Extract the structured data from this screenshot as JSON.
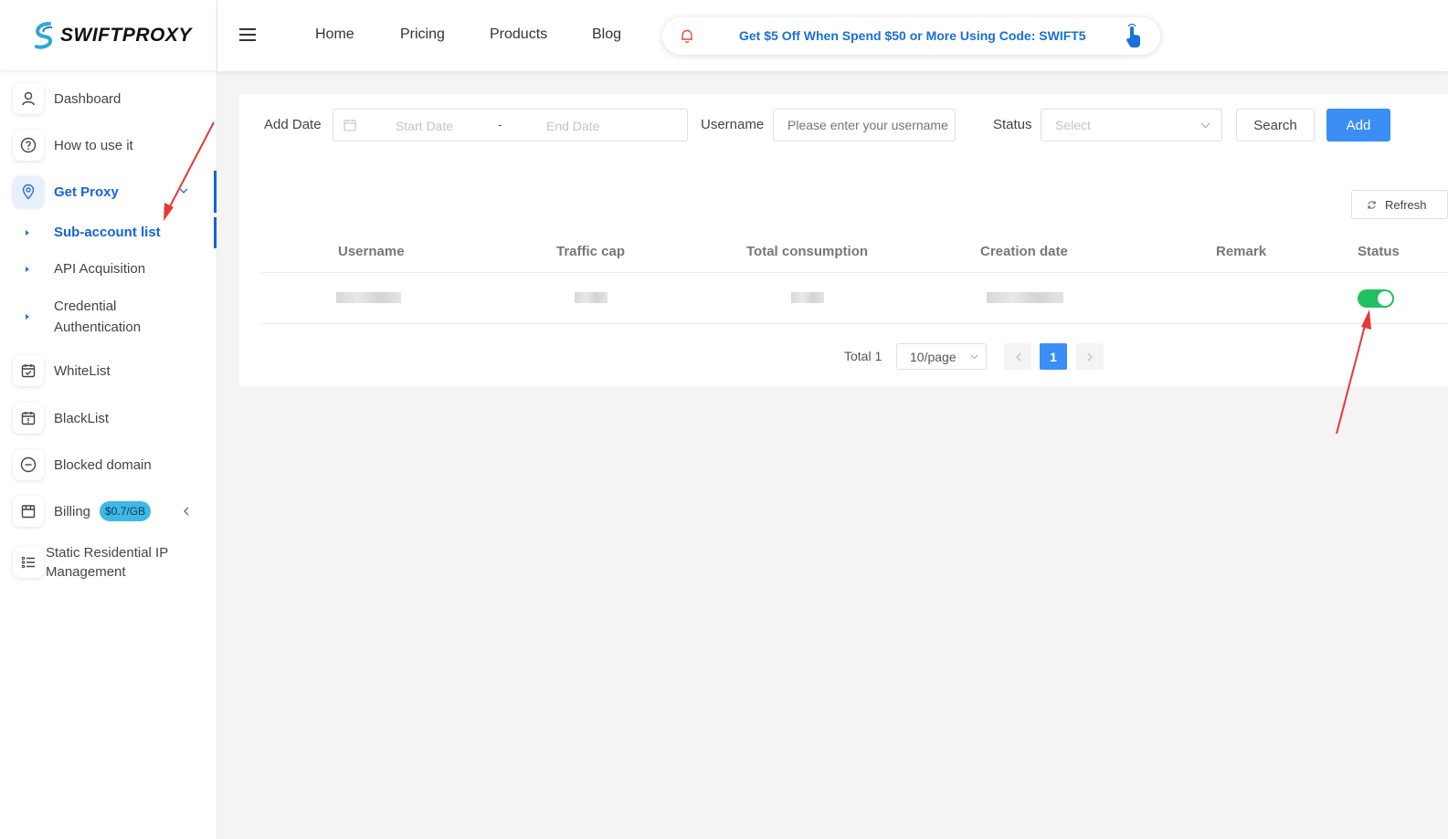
{
  "brand": {
    "name": "SWIFTPROXY"
  },
  "header": {
    "nav": [
      "Home",
      "Pricing",
      "Products",
      "Blog"
    ],
    "promo_text": "Get $5 Off When Spend $50 or More Using Code: SWIFT5"
  },
  "sidebar": {
    "items": [
      {
        "label": "Dashboard",
        "icon": "user-icon"
      },
      {
        "label": "How to use it",
        "icon": "help-icon"
      },
      {
        "label": "Get Proxy",
        "icon": "location-pin-icon",
        "active": true
      },
      {
        "label": "WhiteList",
        "icon": "calendar-check-icon"
      },
      {
        "label": "BlackList",
        "icon": "calendar-alert-icon"
      },
      {
        "label": "Blocked domain",
        "icon": "minus-circle-icon"
      },
      {
        "label": "Billing",
        "icon": "store-icon",
        "badge": "$0.7/GB"
      },
      {
        "label_line1": "Static Residential IP",
        "label_line2": "Management",
        "icon": "list-icon"
      }
    ],
    "sub_items": [
      {
        "label": "Sub-account list",
        "active": true
      },
      {
        "label": "API Acquisition"
      },
      {
        "label_line1": "Credential",
        "label_line2": "Authentication"
      }
    ]
  },
  "filters": {
    "add_date_label": "Add Date",
    "start_placeholder": "Start Date",
    "range_separator": "-",
    "end_placeholder": "End Date",
    "username_label": "Username",
    "username_placeholder": "Please enter your username",
    "status_label": "Status",
    "status_placeholder": "Select",
    "search_label": "Search",
    "add_label": "Add"
  },
  "table": {
    "refresh_label": "Refresh",
    "columns": [
      "Username",
      "Traffic cap",
      "Total consumption",
      "Creation date",
      "Remark",
      "Status"
    ],
    "rows": [
      {
        "status_enabled": true
      }
    ]
  },
  "pagination": {
    "total": "Total 1",
    "page_size": "10/page",
    "current_page": "1"
  },
  "colors": {
    "accent": "#1565d8",
    "primary_button": "#3a8ef6",
    "toggle_on": "#21c063",
    "annotation_arrow": "#e53935"
  }
}
